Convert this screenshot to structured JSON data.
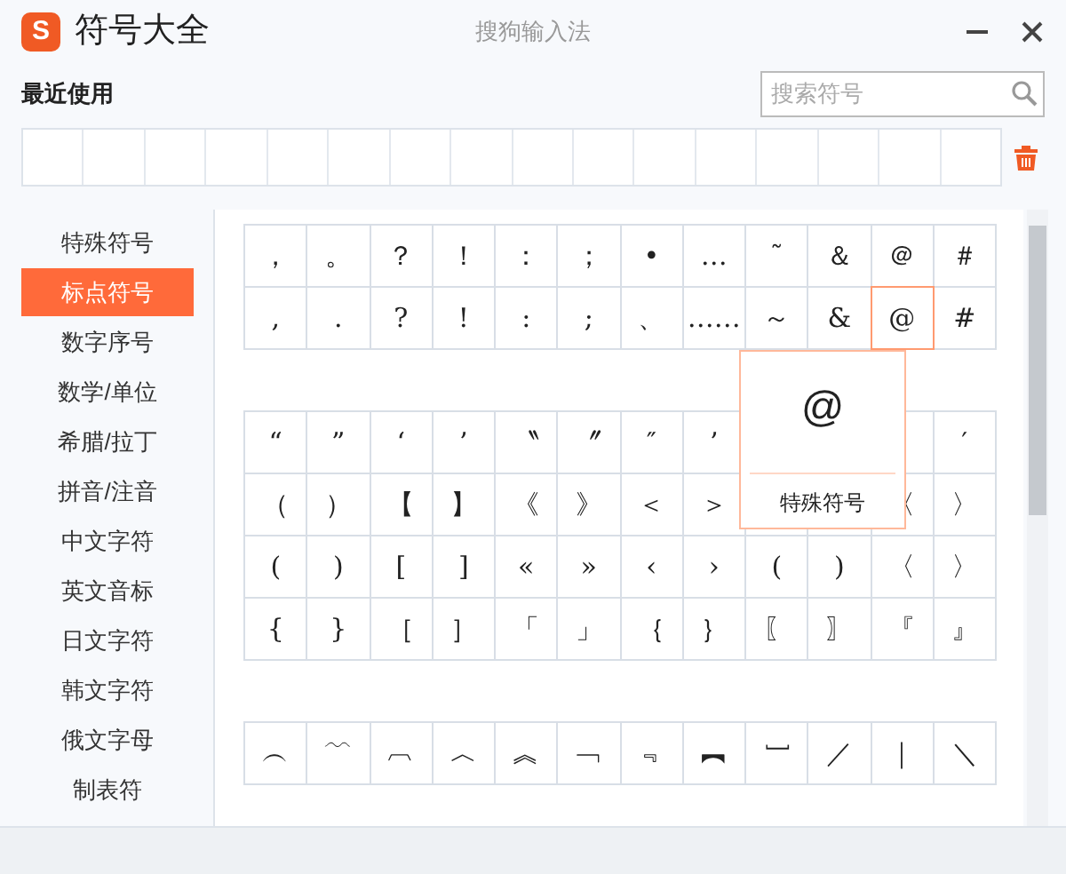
{
  "window": {
    "title": "符号大全",
    "app_name": "搜狗输入法",
    "logo": "S"
  },
  "recent": {
    "label": "最近使用"
  },
  "search": {
    "placeholder": "搜索符号"
  },
  "sidebar": {
    "items": [
      {
        "label": "特殊符号",
        "selected": false
      },
      {
        "label": "标点符号",
        "selected": true
      },
      {
        "label": "数字序号",
        "selected": false
      },
      {
        "label": "数学/单位",
        "selected": false
      },
      {
        "label": "希腊/拉丁",
        "selected": false
      },
      {
        "label": "拼音/注音",
        "selected": false
      },
      {
        "label": "中文字符",
        "selected": false
      },
      {
        "label": "英文音标",
        "selected": false
      },
      {
        "label": "日文字符",
        "selected": false
      },
      {
        "label": "韩文字符",
        "selected": false
      },
      {
        "label": "俄文字母",
        "selected": false
      },
      {
        "label": "制表符",
        "selected": false
      }
    ]
  },
  "groups": [
    {
      "rows": [
        [
          {
            "symbol": "，",
            "selected": false
          },
          {
            "symbol": "。",
            "selected": false
          },
          {
            "symbol": "？",
            "selected": false
          },
          {
            "symbol": "！",
            "selected": false
          },
          {
            "symbol": "：",
            "selected": false
          },
          {
            "symbol": "；",
            "selected": false
          },
          {
            "symbol": "•",
            "selected": false
          },
          {
            "symbol": "…",
            "selected": false
          },
          {
            "symbol": "˜",
            "selected": false
          },
          {
            "symbol": "＆",
            "selected": false
          },
          {
            "symbol": "＠",
            "selected": false
          },
          {
            "symbol": "＃",
            "selected": false
          }
        ],
        [
          {
            "symbol": ",",
            "selected": false
          },
          {
            "symbol": ".",
            "selected": false
          },
          {
            "symbol": "?",
            "selected": false
          },
          {
            "symbol": "!",
            "selected": false
          },
          {
            "symbol": ":",
            "selected": false
          },
          {
            "symbol": ";",
            "selected": false
          },
          {
            "symbol": "、",
            "selected": false
          },
          {
            "symbol": "……",
            "selected": false
          },
          {
            "symbol": "～",
            "selected": false
          },
          {
            "symbol": "&",
            "selected": false
          },
          {
            "symbol": "@",
            "selected": true
          },
          {
            "symbol": "#",
            "selected": false
          }
        ]
      ]
    },
    {
      "rows": [
        [
          {
            "symbol": "“",
            "selected": false
          },
          {
            "symbol": "”",
            "selected": false
          },
          {
            "symbol": "‘",
            "selected": false
          },
          {
            "symbol": "’",
            "selected": false
          },
          {
            "symbol": "〝",
            "selected": false
          },
          {
            "symbol": "〞",
            "selected": false
          },
          {
            "symbol": "″",
            "selected": false
          },
          {
            "symbol": "’",
            "selected": false
          },
          null,
          null,
          null,
          {
            "symbol": "′",
            "selected": false
          }
        ],
        [
          {
            "symbol": "（",
            "selected": false
          },
          {
            "symbol": "）",
            "selected": false
          },
          {
            "symbol": "【",
            "selected": false
          },
          {
            "symbol": "】",
            "selected": false
          },
          {
            "symbol": "《",
            "selected": false
          },
          {
            "symbol": "》",
            "selected": false
          },
          {
            "symbol": "＜",
            "selected": false
          },
          {
            "symbol": "＞",
            "selected": false
          },
          null,
          null,
          {
            "symbol": "〈",
            "selected": false
          },
          {
            "symbol": "〉",
            "selected": false
          }
        ],
        [
          {
            "symbol": "(",
            "selected": false
          },
          {
            "symbol": ")",
            "selected": false
          },
          {
            "symbol": "[",
            "selected": false
          },
          {
            "symbol": "]",
            "selected": false
          },
          {
            "symbol": "«",
            "selected": false
          },
          {
            "symbol": "»",
            "selected": false
          },
          {
            "symbol": "‹",
            "selected": false
          },
          {
            "symbol": "›",
            "selected": false
          },
          {
            "symbol": "(",
            "selected": false
          },
          {
            "symbol": ")",
            "selected": false
          },
          {
            "symbol": "〈",
            "selected": false
          },
          {
            "symbol": "〉",
            "selected": false
          }
        ],
        [
          {
            "symbol": "{",
            "selected": false
          },
          {
            "symbol": "}",
            "selected": false
          },
          {
            "symbol": "［",
            "selected": false
          },
          {
            "symbol": "］",
            "selected": false
          },
          {
            "symbol": "「",
            "selected": false
          },
          {
            "symbol": "」",
            "selected": false
          },
          {
            "symbol": "｛",
            "selected": false
          },
          {
            "symbol": "｝",
            "selected": false
          },
          {
            "symbol": "〖",
            "selected": false
          },
          {
            "symbol": "〗",
            "selected": false
          },
          {
            "symbol": "『",
            "selected": false
          },
          {
            "symbol": "』",
            "selected": false
          }
        ]
      ]
    },
    {
      "rows": [
        [
          {
            "symbol": "︵",
            "selected": false
          },
          {
            "symbol": "﹋",
            "selected": false
          },
          {
            "symbol": "︹",
            "selected": false
          },
          {
            "symbol": "︿",
            "selected": false
          },
          {
            "symbol": "︽",
            "selected": false
          },
          {
            "symbol": "﹁",
            "selected": false
          },
          {
            "symbol": "﹃",
            "selected": false
          },
          {
            "symbol": "︻",
            "selected": false
          },
          {
            "symbol": "﹇",
            "selected": false
          },
          {
            "symbol": "／",
            "selected": false
          },
          {
            "symbol": "｜",
            "selected": false
          },
          {
            "symbol": "＼",
            "selected": false
          }
        ]
      ]
    }
  ],
  "tooltip": {
    "symbol": "@",
    "category": "特殊符号"
  }
}
